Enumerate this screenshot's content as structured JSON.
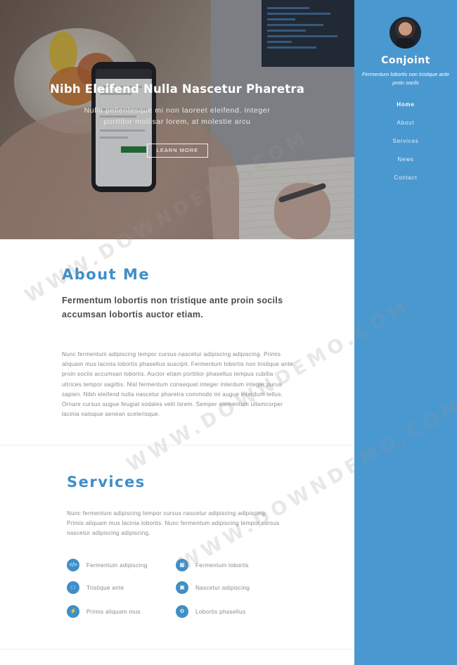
{
  "hero": {
    "title": "Nibh Eleifend Nulla Nascetur Pharetra",
    "subtitle": "Nulla pellentesque mi non laoreet eleifend. Integer porttitor mollisar lorem, at molestie arcu",
    "button_label": "LEARN MORE"
  },
  "sidebar": {
    "brand": "Conjoint",
    "tagline": "Fermentum lobortis non tristique ante proin socils",
    "nav": [
      "Home",
      "About",
      "Services",
      "News",
      "Contact"
    ],
    "active_item": "Home",
    "background_color": "#4a98d0"
  },
  "about": {
    "heading": "About Me",
    "subheading_line1": "Fermentum lobortis non tristique ante proin socils",
    "subheading_line2": "accumsan lobortis auctor etiam.",
    "body": "Nunc fermentum adipiscing tempor cursus nascetur adipiscing adipiscing. Primis aliquam mus lacinia lobortis phasellus suscipit. Fermentum lobortis non tristique ante proin sociis accumsan lobortis. Auctor etiam porttitor phasellus tempus cubilia ultrices tempor sagittis. Nisl fermentum consequat integer interdum integer purus sapien. Nibh eleifend nulla nascetur pharetra commodo mi augue interdum tellus. Ornare cursus augue feugiat sodales velit lorem. Semper elementum ullamcorper lacinia natoque aenean scelerisque."
  },
  "services": {
    "heading": "Services",
    "body": "Nunc fermentum adipiscing tempor cursus nascetur adipiscing adipiscing. Primis aliquam mus lacinia lobortis. Nunc fermentum adipiscing tempor cursus nascetur adipiscing adipiscing.",
    "items": [
      {
        "label": "Fermentum adipiscing",
        "icon": "code-icon"
      },
      {
        "label": "Fermentum lobortis",
        "icon": "cubes-icon"
      },
      {
        "label": "Tristique ante",
        "icon": "tablet-icon"
      },
      {
        "label": "Nascetur adipiscing",
        "icon": "chat-icon"
      },
      {
        "label": "Primis aliquam mus",
        "icon": "bolt-icon"
      },
      {
        "label": "Lobortis phasellus",
        "icon": "gear-icon"
      }
    ]
  },
  "watermark": {
    "text": "WWW.DOWNDEMO.COM"
  },
  "colors": {
    "accent": "#3f8fc7",
    "sidebar": "#4a98d0"
  }
}
